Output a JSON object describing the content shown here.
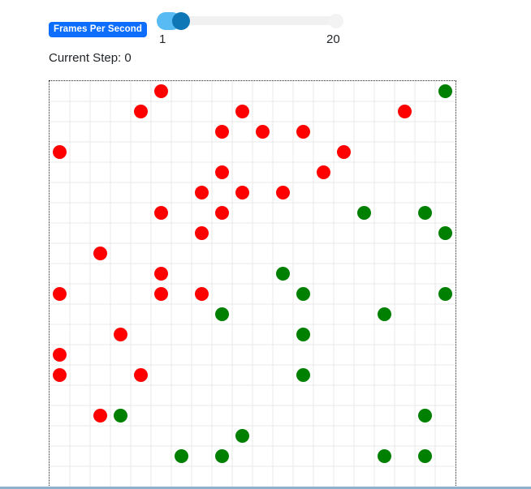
{
  "controls": {
    "fps_label": "Frames Per Second",
    "slider_min_label": "1",
    "slider_max_label": "20",
    "fps_value": 2,
    "fps_min": 1,
    "fps_max": 20
  },
  "status": {
    "step_text": "Current Step: 0"
  },
  "simulation": {
    "grid_size": 20,
    "colors": {
      "red": "#ff0000",
      "green": "#008000",
      "grid_line": "#e8e8e8"
    },
    "red_agents": [
      [
        5,
        0
      ],
      [
        4,
        1
      ],
      [
        9,
        1
      ],
      [
        17,
        1
      ],
      [
        8,
        2
      ],
      [
        10,
        2
      ],
      [
        12,
        2
      ],
      [
        0,
        3
      ],
      [
        14,
        3
      ],
      [
        8,
        4
      ],
      [
        13,
        4
      ],
      [
        7,
        5
      ],
      [
        9,
        5
      ],
      [
        11,
        5
      ],
      [
        5,
        6
      ],
      [
        8,
        6
      ],
      [
        7,
        7
      ],
      [
        2,
        8
      ],
      [
        5,
        9
      ],
      [
        0,
        10
      ],
      [
        5,
        10
      ],
      [
        7,
        10
      ],
      [
        3,
        12
      ],
      [
        0,
        13
      ],
      [
        0,
        14
      ],
      [
        4,
        14
      ],
      [
        2,
        16
      ]
    ],
    "green_agents": [
      [
        19,
        0
      ],
      [
        15,
        6
      ],
      [
        18,
        6
      ],
      [
        19,
        7
      ],
      [
        11,
        9
      ],
      [
        12,
        10
      ],
      [
        19,
        10
      ],
      [
        8,
        11
      ],
      [
        16,
        11
      ],
      [
        12,
        12
      ],
      [
        12,
        14
      ],
      [
        3,
        16
      ],
      [
        18,
        16
      ],
      [
        9,
        17
      ],
      [
        6,
        18
      ],
      [
        8,
        18
      ],
      [
        16,
        18
      ],
      [
        18,
        18
      ]
    ]
  }
}
